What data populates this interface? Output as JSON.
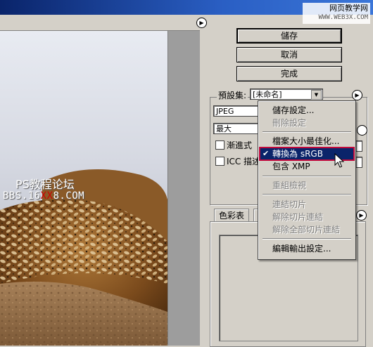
{
  "watermark": {
    "site": "网页教学网",
    "url": "WWW.WEB3X.COM"
  },
  "preview": {
    "overlay_line1": "PS教程论坛",
    "overlay_line2_a": "BBS.16",
    "overlay_line2_red": "XX",
    "overlay_line2_b": "8.COM"
  },
  "buttons": {
    "save": "儲存",
    "cancel": "取消",
    "done": "完成"
  },
  "settings": {
    "preset_label": "預設集:",
    "preset_value": "[未命名]",
    "format_value": "JPEG",
    "quality_value": "最大",
    "progressive_label": "漸進式",
    "icc_label": "ICC 描述"
  },
  "tabs": {
    "color_table": "色彩表"
  },
  "menu": {
    "items": [
      {
        "label": "儲存設定...",
        "state": "enabled"
      },
      {
        "label": "刪除設定",
        "state": "disabled"
      },
      {
        "label": "檔案大小最佳化...",
        "state": "enabled"
      },
      {
        "label": "轉換為 sRGB",
        "state": "checked"
      },
      {
        "label": "包含 XMP",
        "state": "enabled"
      },
      {
        "label": "重組檢視",
        "state": "disabled"
      },
      {
        "label": "連結切片",
        "state": "disabled"
      },
      {
        "label": "解除切片連結",
        "state": "disabled"
      },
      {
        "label": "解除全部切片連結",
        "state": "disabled"
      },
      {
        "label": "編輯輸出設定...",
        "state": "enabled"
      }
    ]
  },
  "colors": {
    "highlight": "#0a246a",
    "selection_outline": "#c00a3c",
    "dialog": "#d4d0c8"
  }
}
